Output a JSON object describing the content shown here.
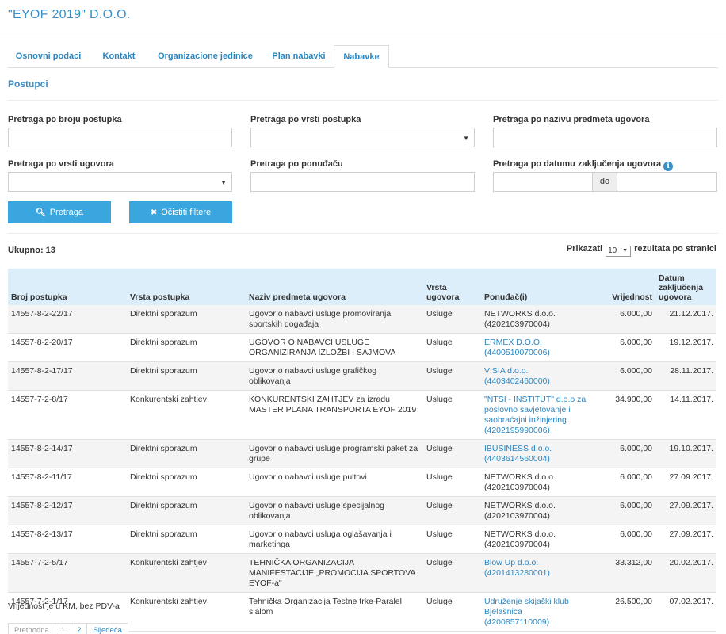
{
  "title": "\"EYOF 2019\" D.O.O.",
  "tabs": [
    {
      "label": "Osnovni podaci",
      "active": false
    },
    {
      "label": "Kontakt",
      "active": false
    },
    {
      "label": "Organizacione jedinice",
      "active": false
    },
    {
      "label": "Plan nabavki",
      "active": false
    },
    {
      "label": "Nabavke",
      "active": true
    }
  ],
  "section_title": "Postupci",
  "filters": {
    "broj_postupka_label": "Pretraga po broju postupka",
    "vrsta_postupka_label": "Pretraga po vrsti postupka",
    "naziv_predmeta_label": "Pretraga po nazivu predmeta ugovora",
    "vrsta_ugovora_label": "Pretraga po vrsti ugovora",
    "ponudjac_label": "Pretraga po ponuđaču",
    "datum_label": "Pretraga po datumu zaključenja ugovora",
    "do_label": "do"
  },
  "buttons": {
    "search": "Pretraga",
    "clear": "Očistiti filtere"
  },
  "summary": {
    "ukupno": "Ukupno: 13",
    "prikazati": "Prikazati",
    "per_page": "10",
    "rezultata": "rezultata po stranici"
  },
  "table": {
    "headers": {
      "broj": "Broj postupka",
      "vrsta_postupka": "Vrsta postupka",
      "naziv": "Naziv predmeta ugovora",
      "vrsta_ugovora": "Vrsta ugovora",
      "ponudjac": "Ponuđač(i)",
      "vrijednost": "Vrijednost",
      "datum": "Datum zaključenja ugovora"
    },
    "rows": [
      {
        "broj": "14557-8-2-22/17",
        "vrsta_postupka": "Direktni sporazum",
        "naziv": "Ugovor o nabavci usluge promoviranja sportskih događaja",
        "vrsta_ugovora": "Usluge",
        "ponudjac": "NETWORKS d.o.o. (4202103970004)",
        "linked": false,
        "vrijednost": "6.000,00",
        "datum": "21.12.2017."
      },
      {
        "broj": "14557-8-2-20/17",
        "vrsta_postupka": "Direktni sporazum",
        "naziv": "UGOVOR O NABAVCI USLUGE ORGANIZIRANJA IZLOŽBI I SAJMOVA",
        "vrsta_ugovora": "Usluge",
        "ponudjac": "ERMEX D.O.O. (4400510070006)",
        "linked": true,
        "vrijednost": "6.000,00",
        "datum": "19.12.2017."
      },
      {
        "broj": "14557-8-2-17/17",
        "vrsta_postupka": "Direktni sporazum",
        "naziv": "Ugovor o nabavci usluge grafičkog oblikovanja",
        "vrsta_ugovora": "Usluge",
        "ponudjac": "VISIA d.o.o. (4403402460000)",
        "linked": true,
        "vrijednost": "6.000,00",
        "datum": "28.11.2017."
      },
      {
        "broj": "14557-7-2-8/17",
        "vrsta_postupka": "Konkurentski zahtjev",
        "naziv": "KONKURENTSKI ZAHTJEV za izradu MASTER PLANA TRANSPORTA EYOF 2019",
        "vrsta_ugovora": "Usluge",
        "ponudjac": "\"NTSI - INSTITUT\" d.o.o za poslovno savjetovanje i saobraćajni inžinjering (4202195990006)",
        "linked": true,
        "vrijednost": "34.900,00",
        "datum": "14.11.2017."
      },
      {
        "broj": "14557-8-2-14/17",
        "vrsta_postupka": "Direktni sporazum",
        "naziv": "Ugovor o nabavci usluge programski paket za grupe",
        "vrsta_ugovora": "Usluge",
        "ponudjac": "IBUSINESS d.o.o. (4403614560004)",
        "linked": true,
        "vrijednost": "6.000,00",
        "datum": "19.10.2017."
      },
      {
        "broj": "14557-8-2-11/17",
        "vrsta_postupka": "Direktni sporazum",
        "naziv": "Ugovor o nabavci usluge pultovi",
        "vrsta_ugovora": "Usluge",
        "ponudjac": "NETWORKS d.o.o. (4202103970004)",
        "linked": false,
        "vrijednost": "6.000,00",
        "datum": "27.09.2017."
      },
      {
        "broj": "14557-8-2-12/17",
        "vrsta_postupka": "Direktni sporazum",
        "naziv": "Ugovor o nabavci usluge specijalnog oblikovanja",
        "vrsta_ugovora": "Usluge",
        "ponudjac": "NETWORKS d.o.o. (4202103970004)",
        "linked": false,
        "vrijednost": "6.000,00",
        "datum": "27.09.2017."
      },
      {
        "broj": "14557-8-2-13/17",
        "vrsta_postupka": "Direktni sporazum",
        "naziv": "Ugovor o nabavci usluga oglašavanja i marketinga",
        "vrsta_ugovora": "Usluge",
        "ponudjac": "NETWORKS d.o.o. (4202103970004)",
        "linked": false,
        "vrijednost": "6.000,00",
        "datum": "27.09.2017."
      },
      {
        "broj": "14557-7-2-5/17",
        "vrsta_postupka": "Konkurentski zahtjev",
        "naziv": "TEHNIČKA ORGANIZACIJA MANIFESTACIJE „PROMOCIJA SPORTOVA EYOF-a\"",
        "vrsta_ugovora": "Usluge",
        "ponudjac": "Blow Up d.o.o. (4201413280001)",
        "linked": true,
        "vrijednost": "33.312,00",
        "datum": "20.02.2017."
      },
      {
        "broj": "14557-7-2-1/17",
        "vrsta_postupka": "Konkurentski zahtjev",
        "naziv": "Tehnička Organizacija Testne trke-Paralel slalom",
        "vrsta_ugovora": "Usluge",
        "ponudjac": "Udruženje skijaški klub Bjelašnica (4200857110009)",
        "linked": true,
        "vrijednost": "26.500,00",
        "datum": "07.02.2017."
      }
    ]
  },
  "footnote": "Vrijednost je u KM, bez PDV-a",
  "pagination": {
    "prev": "Prethodna",
    "pages": [
      "1",
      "2"
    ],
    "next": "Sljedeća"
  }
}
